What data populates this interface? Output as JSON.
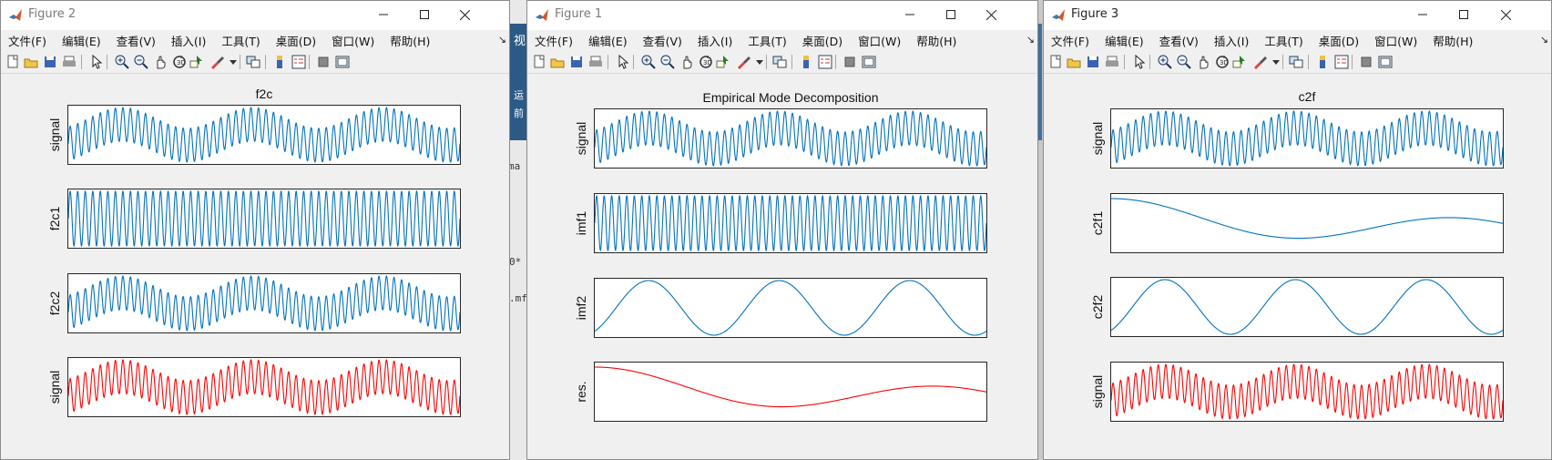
{
  "menu_labels": [
    "文件(F)",
    "编辑(E)",
    "查看(V)",
    "插入(I)",
    "工具(T)",
    "桌面(D)",
    "窗口(W)",
    "帮助(H)"
  ],
  "windows": [
    {
      "id": "figure2",
      "title": "Figure 2",
      "active": false,
      "figure_title": "f2c",
      "axes": [
        {
          "ylabel": "signal",
          "series": "signal",
          "color": "#0072bd"
        },
        {
          "ylabel": "f2c1",
          "series": "high",
          "color": "#0072bd"
        },
        {
          "ylabel": "f2c2",
          "series": "signal",
          "color": "#0072bd"
        },
        {
          "ylabel": "signal",
          "series": "signal",
          "color": "#ff0000"
        }
      ]
    },
    {
      "id": "figure1",
      "title": "Figure 1",
      "active": false,
      "figure_title": "Empirical Mode Decomposition",
      "axes": [
        {
          "ylabel": "signal",
          "series": "signal",
          "color": "#0072bd"
        },
        {
          "ylabel": "imf1",
          "series": "high",
          "color": "#0072bd"
        },
        {
          "ylabel": "imf2",
          "series": "mid",
          "color": "#0072bd"
        },
        {
          "ylabel": "res.",
          "series": "trend",
          "color": "#ff0000"
        }
      ]
    },
    {
      "id": "figure3",
      "title": "Figure 3",
      "active": true,
      "figure_title": "c2f",
      "axes": [
        {
          "ylabel": "signal",
          "series": "signal",
          "color": "#0072bd"
        },
        {
          "ylabel": "c2f1",
          "series": "trend",
          "color": "#0072bd"
        },
        {
          "ylabel": "c2f2",
          "series": "mid",
          "color": "#0072bd"
        },
        {
          "ylabel": "signal",
          "series": "signal",
          "color": "#ff0000"
        }
      ]
    }
  ],
  "background_window_text": {
    "tab": "视",
    "line1": "运",
    "line2": "前",
    "editor_tab": "ma",
    "code1": "0*",
    "code2": ".mf"
  }
}
